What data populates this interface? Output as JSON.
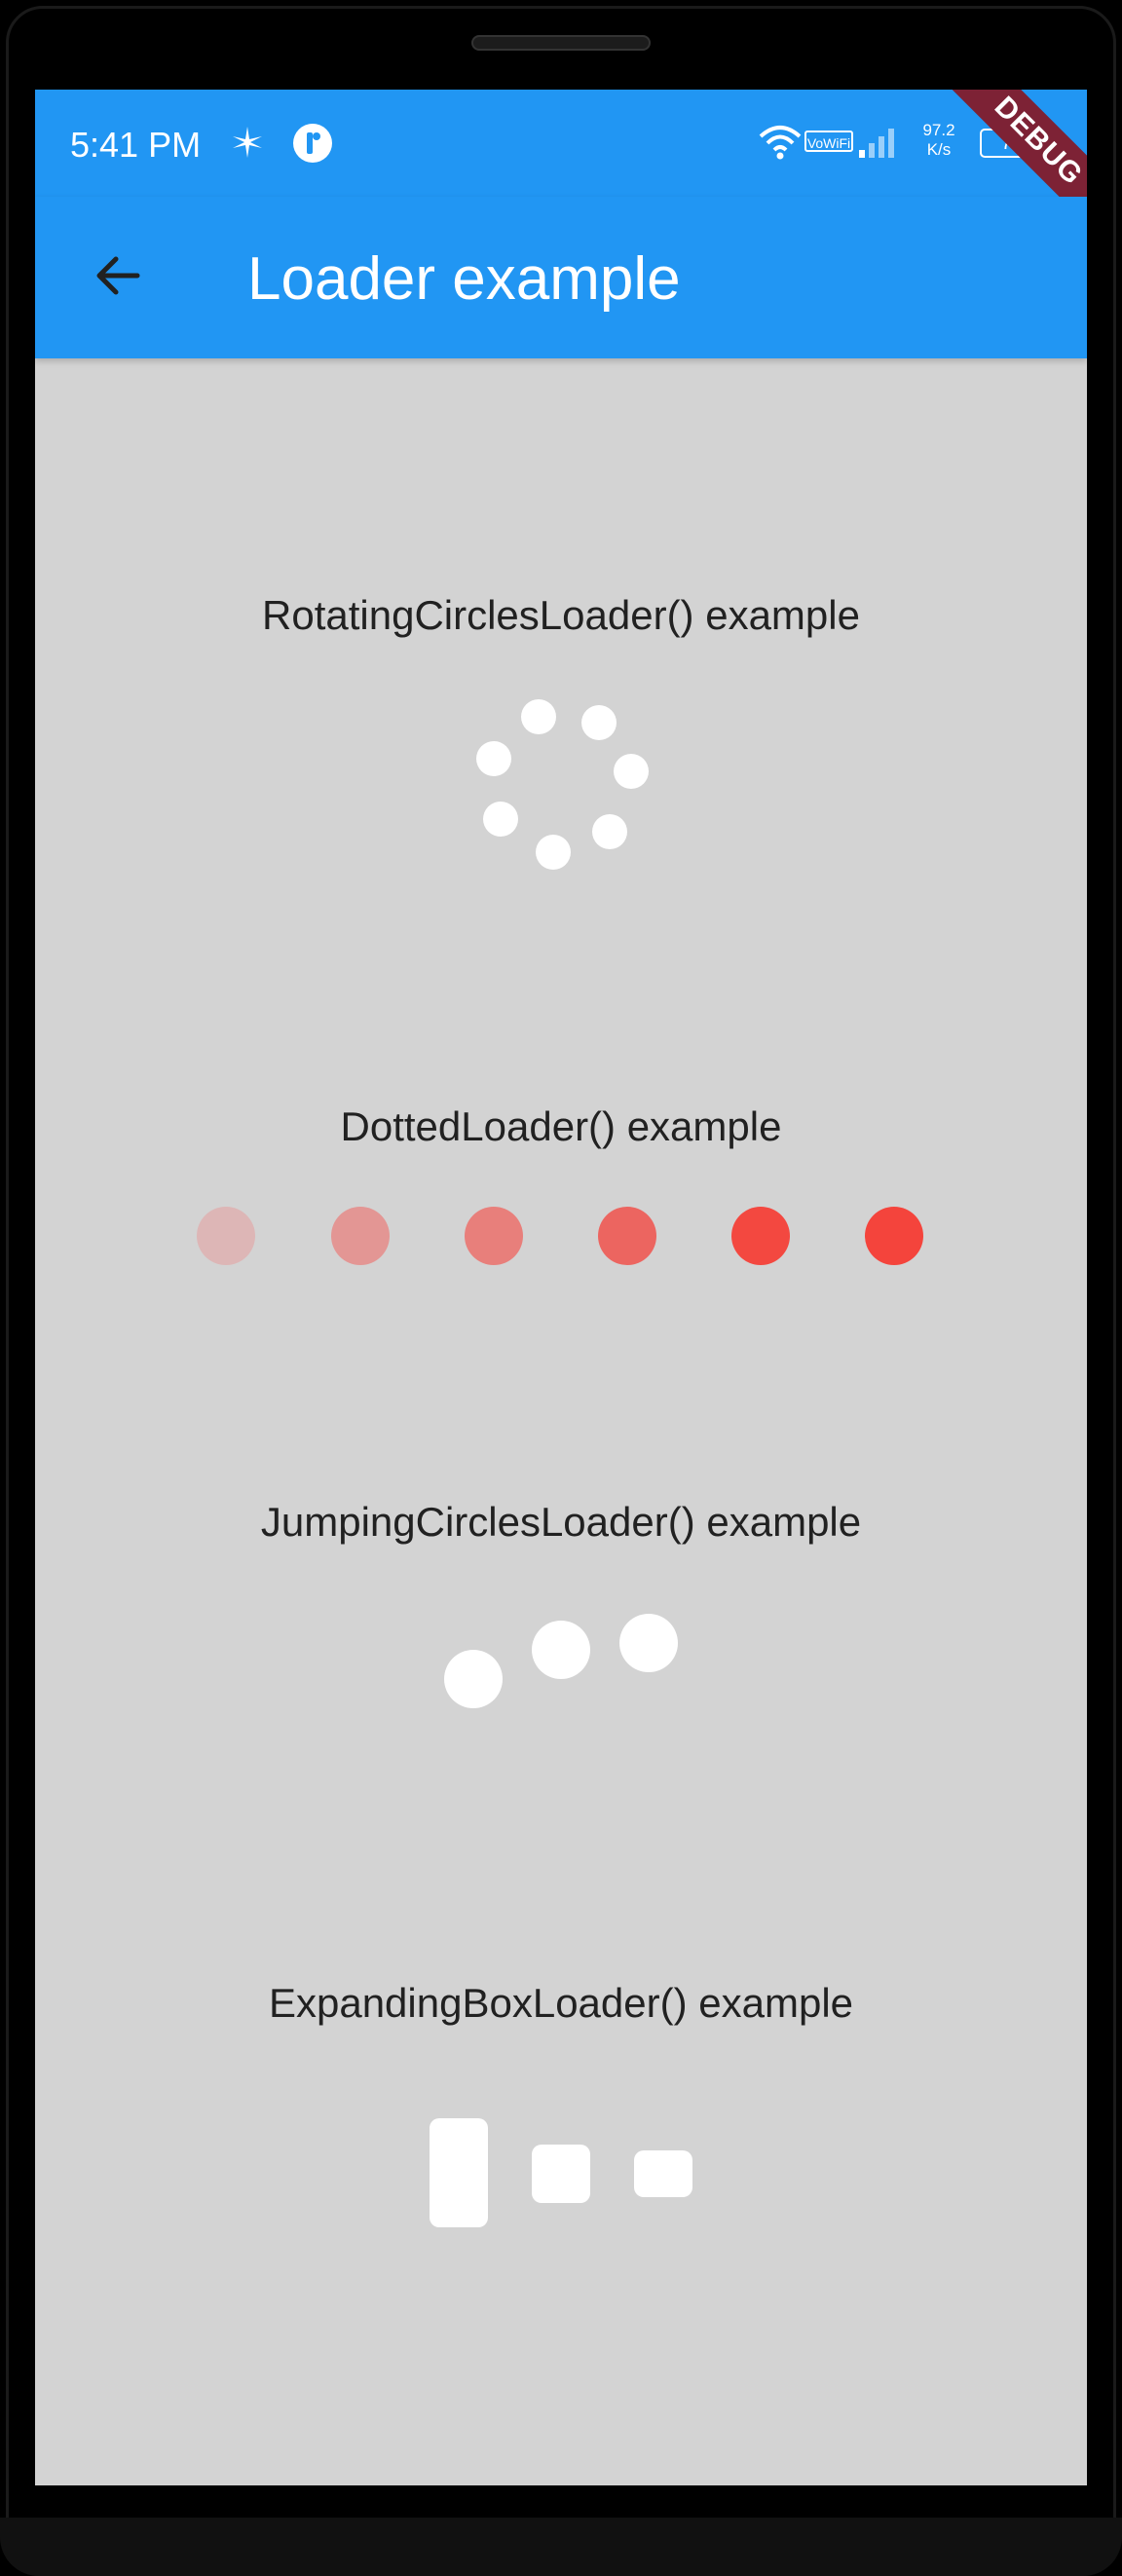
{
  "statusbar": {
    "time": "5:41 PM",
    "speed_value": "97.2",
    "speed_unit": "K/s",
    "battery": "73",
    "vowifi": "VoWiFi",
    "icons": [
      "sparkle-icon",
      "app-notification-icon",
      "wifi-icon",
      "vowifi-icon",
      "signal-icon",
      "battery-icon"
    ]
  },
  "appbar": {
    "title": "Loader example",
    "back_icon": "arrow-back-icon",
    "color": "#2196f3"
  },
  "debug_banner": "DEBUG",
  "sections": [
    {
      "label": "RotatingCirclesLoader() example",
      "loader": "rotating-circles",
      "color": "#ffffff"
    },
    {
      "label": "DottedLoader() example",
      "loader": "dotted",
      "colors": [
        "#ddb6b6",
        "#e39694",
        "#e87f7b",
        "#ec6560",
        "#f34840",
        "#f4443c"
      ]
    },
    {
      "label": "JumpingCirclesLoader() example",
      "loader": "jumping-circles",
      "color": "#ffffff"
    },
    {
      "label": "ExpandingBoxLoader() example",
      "loader": "expanding-box",
      "color": "#ffffff"
    }
  ],
  "colors": {
    "background": "#d3d3d3",
    "text": "#212121",
    "debug": "#7d2235"
  }
}
